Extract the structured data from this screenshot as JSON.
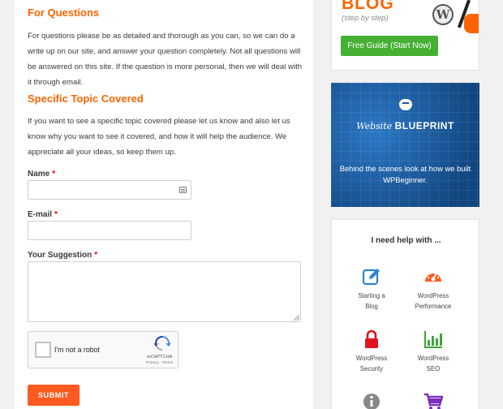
{
  "main": {
    "questions": {
      "heading": "For Questions",
      "body": "For questions please be as detailed and thorough as you can, so we can do a write up on our site, and answer your question completely. Not all questions will be answered on this site. If the question is more personal, then we will deal with it through email."
    },
    "topic": {
      "heading": "Specific Topic Covered",
      "body": "If you want to see a specific topic covered please let us know and also let us know why you want to see it covered, and how it will help the audience. We appreciate all your ideas, so keep them up."
    },
    "form": {
      "name_label": "Name",
      "email_label": "E-mail",
      "suggestion_label": "Your Suggestion",
      "required_mark": "*",
      "name_value": "",
      "email_value": "",
      "suggestion_value": "",
      "captcha_text": "I'm not a robot",
      "captcha_brand": "reCAPTCHA",
      "captcha_links": "Privacy - Terms",
      "submit_label": "SUBMIT"
    }
  },
  "sidebar": {
    "blog_ad": {
      "title": "BLOG",
      "subtitle": "(step by step)",
      "button": "Free Guide (Start Now)"
    },
    "blueprint_ad": {
      "title_italic": "Website",
      "title_bold": "BLUEPRINT",
      "description": "Behind the scenes look at how we built WPBeginner."
    },
    "help": {
      "title": "I need help with ...",
      "items": [
        {
          "line1": "Starting a",
          "line2": "Blog",
          "icon": "edit-icon"
        },
        {
          "line1": "WordPress",
          "line2": "Performance",
          "icon": "speedometer-icon"
        },
        {
          "line1": "WordPress",
          "line2": "Security",
          "icon": "lock-icon"
        },
        {
          "line1": "WordPress",
          "line2": "SEO",
          "icon": "bar-chart-icon"
        },
        {
          "line1": "",
          "line2": "",
          "icon": "info-icon"
        },
        {
          "line1": "",
          "line2": "",
          "icon": "cart-icon"
        }
      ]
    }
  },
  "colors": {
    "heading_orange": "#ff6400",
    "submit_orange": "#ff5a1f",
    "green_button": "#46b034",
    "icon_blue": "#2e83d6",
    "icon_red": "#e0131f",
    "icon_green": "#3fa535",
    "icon_purple": "#7b2fbe",
    "blueprint_blue": "#1a5a9c"
  }
}
